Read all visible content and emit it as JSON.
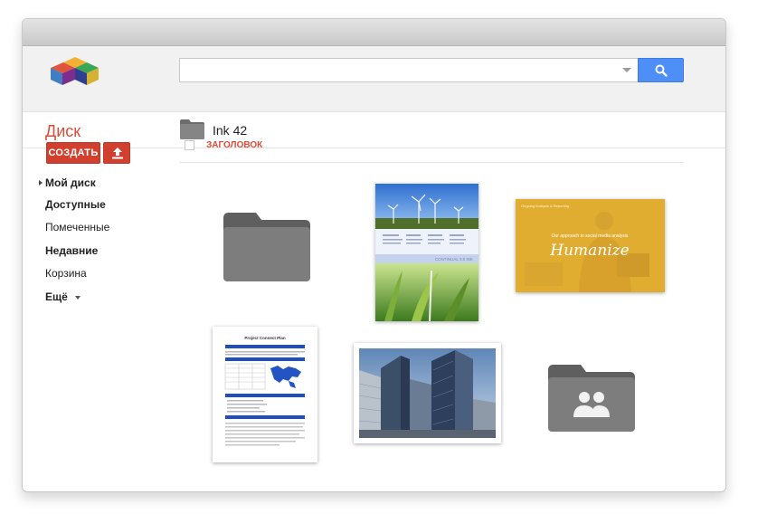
{
  "header": {
    "search": {
      "value": "",
      "placeholder": ""
    }
  },
  "subbar": {
    "drive_title": "Диск",
    "folder_title": "Ink 42"
  },
  "sidebar": {
    "create_label": "СОЗДАТЬ",
    "items": [
      {
        "label": "Мой диск",
        "bold": true,
        "expand_arrow": true
      },
      {
        "label": "Доступные",
        "bold": true
      },
      {
        "label": "Помеченные",
        "bold": false
      },
      {
        "label": "Недавние",
        "bold": true
      },
      {
        "label": "Корзина",
        "bold": false
      },
      {
        "label": "Ещё",
        "bold": true,
        "dropdown": true
      }
    ]
  },
  "content": {
    "list_header": "ЗАГОЛОВОК",
    "items": [
      {
        "kind": "folder",
        "icon": "folder-icon"
      },
      {
        "kind": "document-thumbnail",
        "preview_text": "CONTINUAL 3.0 INK"
      },
      {
        "kind": "presentation-thumbnail",
        "preview_title": "Humanize",
        "preview_subtitle": "Our approach to social media analysis",
        "preview_tag": "Ongoing Analysis & Reporting"
      },
      {
        "kind": "document-thumbnail",
        "preview_title": "Project Connect Plan"
      },
      {
        "kind": "image-thumbnail"
      },
      {
        "kind": "shared-folder",
        "icon": "shared-folder-icon"
      }
    ]
  },
  "colors": {
    "accent_red": "#dd4b39",
    "create_button": "#d1402f",
    "search_button": "#4d8ef7",
    "folder_gray": "#7d7d7d",
    "topbar_bg": "#f1f1f1",
    "presentation_yellow": "#e9b632"
  }
}
